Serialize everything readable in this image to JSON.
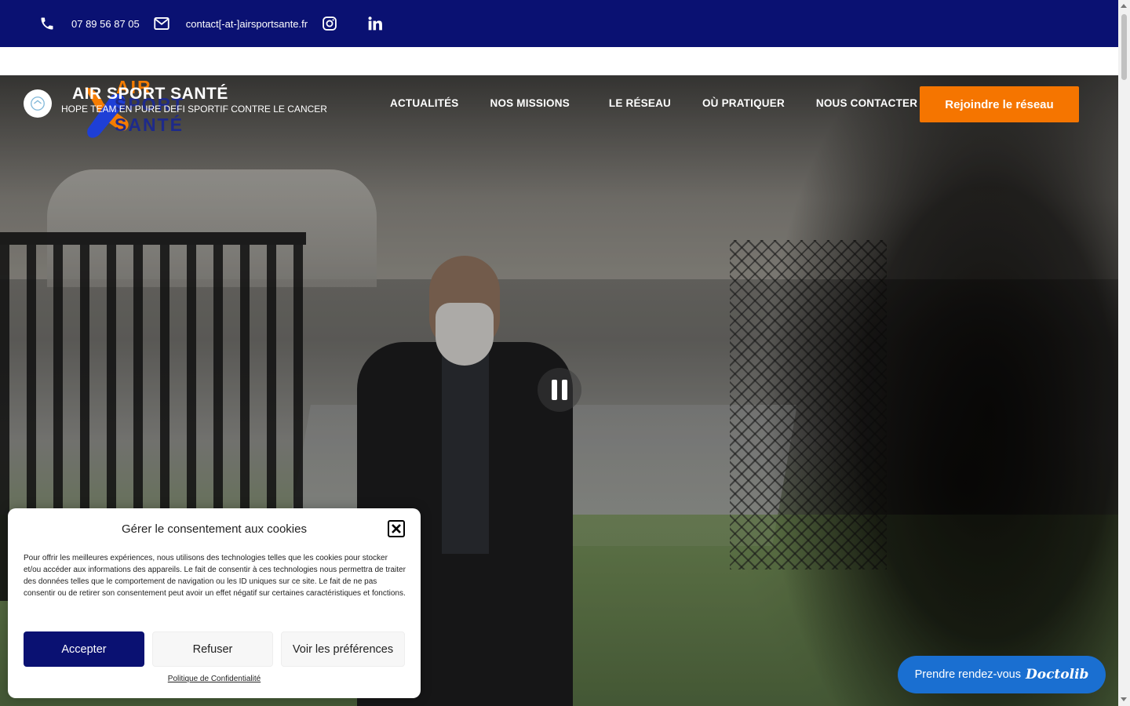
{
  "topbar": {
    "phone": "07 89 56 87 05",
    "email": "contact[-at-]airsportsante.fr",
    "icons": [
      "phone-icon",
      "envelope-icon",
      "instagram-icon",
      "linkedin-icon"
    ]
  },
  "logo": {
    "title": "AIR SPORT SANTÉ",
    "subtitle": "HOPE TEAM EN PURE DEFI SPORTIF CONTRE LE CANCER",
    "word_air": "AIR",
    "word_sport": "SPORT",
    "word_sante": "SANTÉ"
  },
  "nav": {
    "items": [
      "ACTUALITÉS",
      "NOS MISSIONS",
      "LE RÉSEAU",
      "OÙ PRATIQUER",
      "NOUS CONTACTER"
    ],
    "cta": "Rejoindre le réseau"
  },
  "cookie": {
    "title": "Gérer le consentement aux cookies",
    "text": "Pour offrir les meilleures expériences, nous utilisons des technologies telles que les cookies pour stocker et/ou accéder aux informations des appareils. Le fait de consentir à ces technologies nous permettra de traiter des données telles que le comportement de navigation ou les ID uniques sur ce site. Le fait de ne pas consentir ou de retirer son consentement peut avoir un effet négatif sur certaines caractéristiques et fonctions.",
    "accept": "Accepter",
    "refuse": "Refuser",
    "preferences": "Voir les préférences",
    "policy_link": "Politique de Confidentialité"
  },
  "doctolib": {
    "label": "Prendre rendez-vous",
    "brand": "Doctolib"
  },
  "colors": {
    "navy": "#0a1172",
    "orange": "#f57500",
    "doctolib_blue": "#1a6fd1"
  }
}
